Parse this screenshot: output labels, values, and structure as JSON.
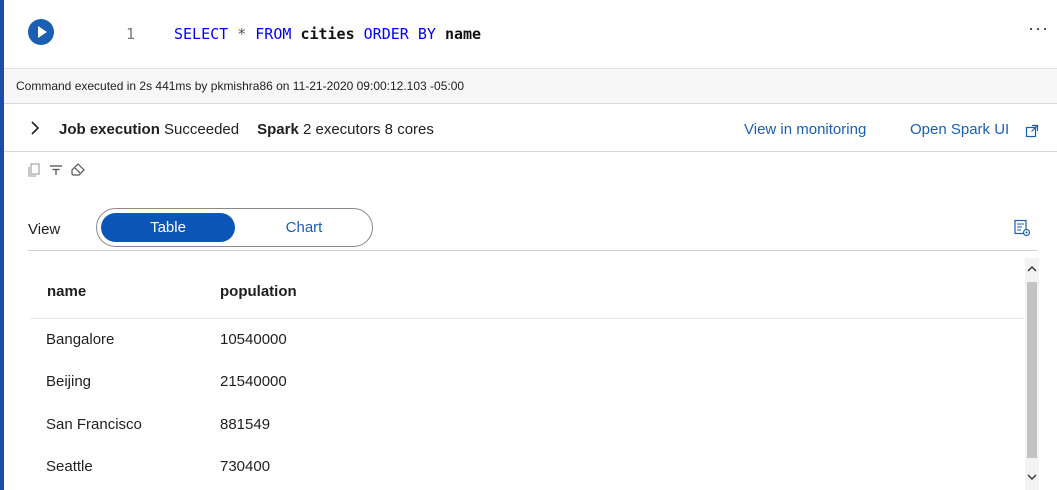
{
  "code": {
    "line_number": "1",
    "tokens": {
      "kw_select": "SELECT",
      "star": "*",
      "kw_from": "FROM",
      "table": "cities",
      "kw_order_by": "ORDER BY",
      "column": "name"
    },
    "more_label": "···"
  },
  "status": {
    "text": "Command executed in 2s 441ms by pkmishra86 on 11-21-2020 09:00:12.103 -05:00"
  },
  "job": {
    "job_label": "Job execution",
    "job_status": "Succeeded",
    "spark_label": "Spark",
    "spark_detail": "2 executors 8 cores",
    "monitor_link": "View in monitoring",
    "spark_ui_link": "Open Spark UI"
  },
  "view": {
    "label": "View",
    "options": [
      "Table",
      "Chart"
    ],
    "selected": "Table"
  },
  "table": {
    "columns": [
      "name",
      "population"
    ],
    "rows": [
      [
        "Bangalore",
        "10540000"
      ],
      [
        "Beijing",
        "21540000"
      ],
      [
        "San Francisco",
        "881549"
      ],
      [
        "Seattle",
        "730400"
      ]
    ]
  },
  "colors": {
    "accent": "#1a5fb4",
    "toggle_active": "#0c56b8",
    "keyword": "#0000ff"
  },
  "icons": [
    "play-icon",
    "more-icon",
    "chevron-right-icon",
    "external-link-icon",
    "copy-icon",
    "filter-icon",
    "eraser-icon",
    "table-settings-icon",
    "scroll-up-icon",
    "scroll-down-icon"
  ]
}
